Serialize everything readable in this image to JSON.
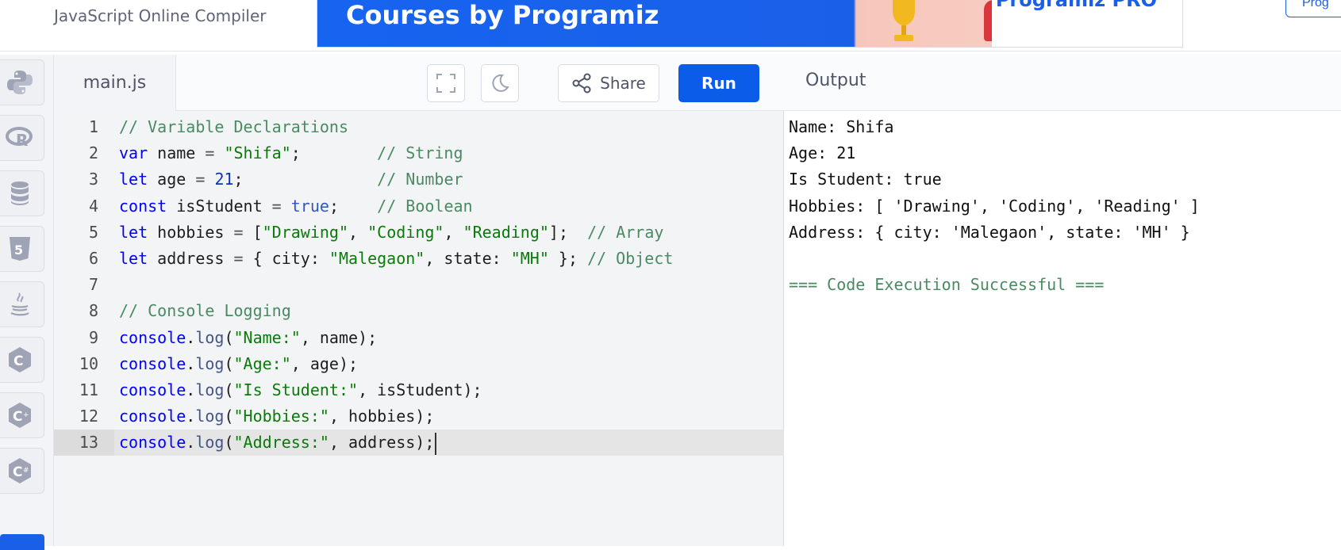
{
  "header": {
    "app_title": "JavaScript Online Compiler",
    "banner_text": "Courses by Programiz",
    "banner_brand": "Programiz PRO",
    "top_right_button": "Prog"
  },
  "rail": {
    "items": [
      {
        "icon": "python-icon"
      },
      {
        "icon": "r-icon"
      },
      {
        "icon": "database-icon"
      },
      {
        "icon": "html5-icon"
      },
      {
        "icon": "java-icon"
      },
      {
        "icon": "c-icon"
      },
      {
        "icon": "cpp-icon"
      },
      {
        "icon": "csharp-icon"
      }
    ]
  },
  "editor": {
    "filename": "main.js",
    "share_label": "Share",
    "run_label": "Run",
    "active_line": 13,
    "lines": [
      "// Variable Declarations",
      "var name = \"Shifa\";        // String",
      "let age = 21;              // Number",
      "const isStudent = true;    // Boolean",
      "let hobbies = [\"Drawing\", \"Coding\", \"Reading\"];  // Array",
      "let address = { city: \"Malegaon\", state: \"MH\" }; // Object",
      "",
      "// Console Logging",
      "console.log(\"Name:\", name);",
      "console.log(\"Age:\", age);",
      "console.log(\"Is Student:\", isStudent);",
      "console.log(\"Hobbies:\", hobbies);",
      "console.log(\"Address:\", address);"
    ]
  },
  "output": {
    "title": "Output",
    "lines": [
      "Name: Shifa",
      "Age: 21",
      "Is Student: true",
      "Hobbies: [ 'Drawing', 'Coding', 'Reading' ]",
      "Address: { city: 'Malegaon', state: 'MH' }",
      "",
      "=== Code Execution Successful ==="
    ]
  },
  "colors": {
    "run_button": "#0b5ce8",
    "keyword": "#0000ff",
    "string": "#0a7a0a",
    "comment": "#4a8a63"
  }
}
